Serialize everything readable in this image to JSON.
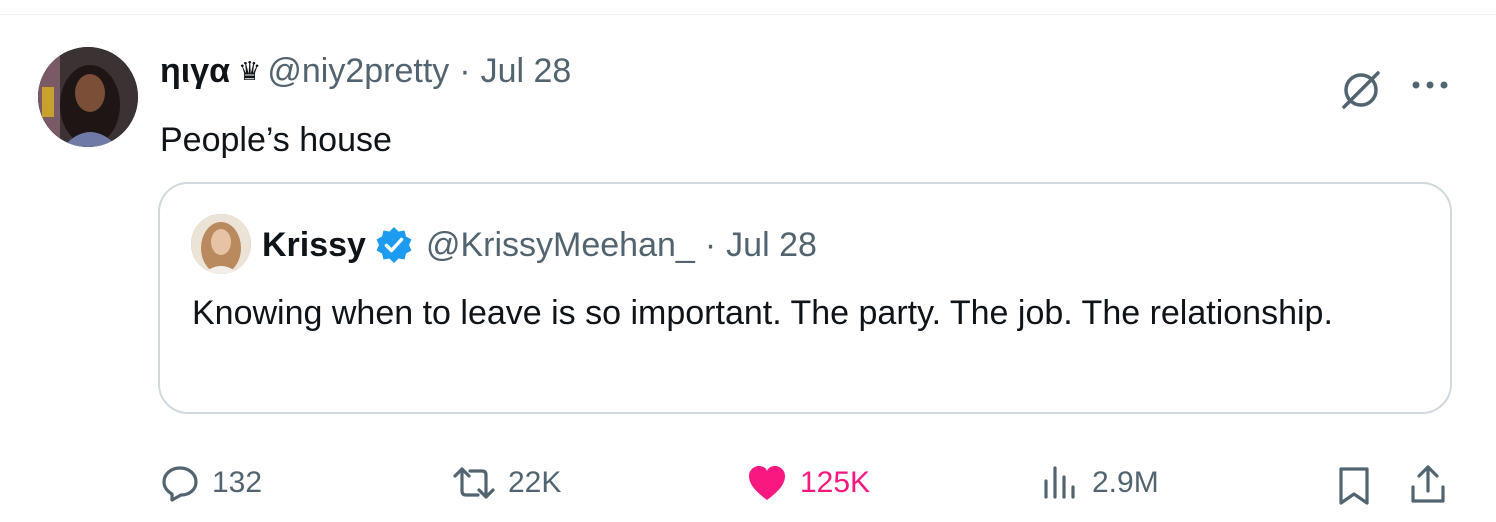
{
  "tweet": {
    "author_name": "ηιγα",
    "author_badge": "♛",
    "handle": "@niy2pretty",
    "separator": "·",
    "date": "Jul 28",
    "text": "People’s house",
    "avatar_icon": "user-avatar-photo",
    "grok_icon": "grok-icon",
    "more_icon": "more-options-icon"
  },
  "quote": {
    "author_name": "Krissy",
    "verified_icon": "verified-badge-icon",
    "handle": "@KrissyMeehan_",
    "separator": "·",
    "date": "Jul 28",
    "text": "Knowing when to leave is so important. The party. The job. The relationship."
  },
  "actions": {
    "replies": "132",
    "reposts": "22K",
    "likes": "125K",
    "views": "2.9M"
  },
  "colors": {
    "text": "#0f1419",
    "muted": "#536471",
    "border": "#cfd9de",
    "like": "#f91880",
    "verified": "#1d9bf0"
  }
}
